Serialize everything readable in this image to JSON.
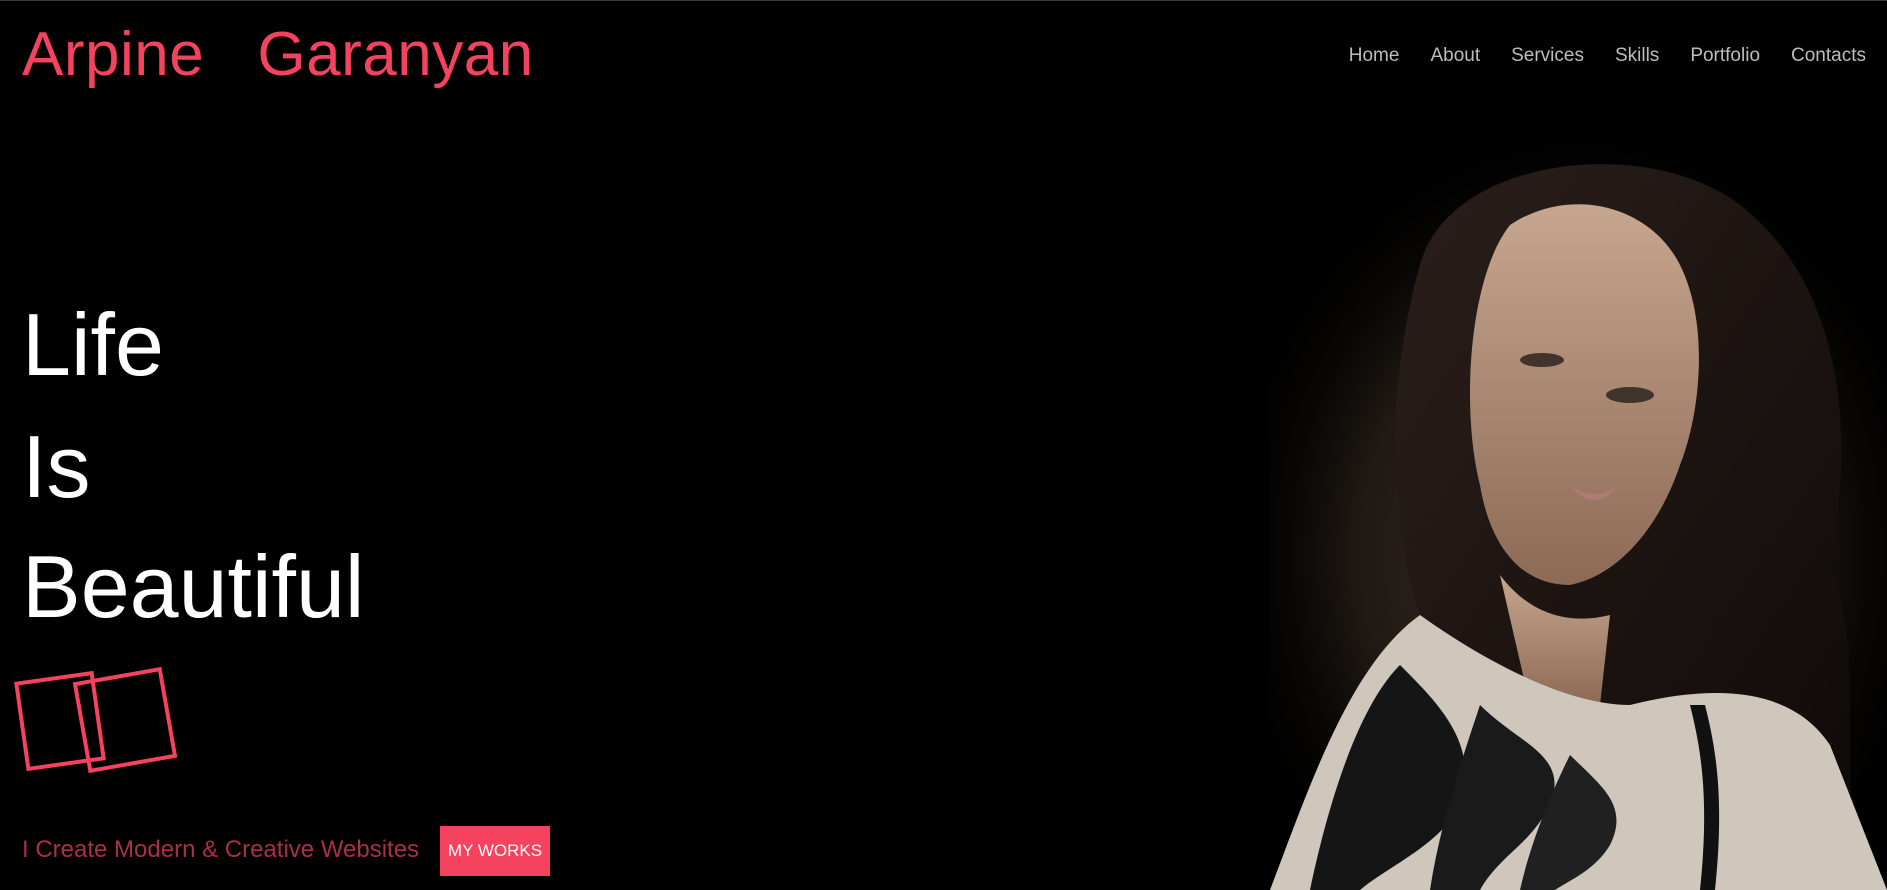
{
  "header": {
    "logo_first": "Arpine",
    "logo_last": "Garanyan"
  },
  "nav": {
    "items": [
      {
        "label": "Home"
      },
      {
        "label": "About"
      },
      {
        "label": "Services"
      },
      {
        "label": "Skills"
      },
      {
        "label": "Portfolio"
      },
      {
        "label": "Contacts"
      }
    ]
  },
  "hero": {
    "lines": [
      "Life",
      "Is",
      "Beautiful"
    ],
    "tagline": "I Create Modern & Creative Websites",
    "cta_label": "MY WORKS"
  },
  "colors": {
    "accent": "#f4425f",
    "background": "#000000",
    "hero_text": "#ffffff",
    "nav_text": "#bdbdbd",
    "tagline_text": "#ab2f45"
  },
  "images": {
    "portrait": "woman-portrait-photo",
    "decoration": "overlapping-squares-outline"
  }
}
